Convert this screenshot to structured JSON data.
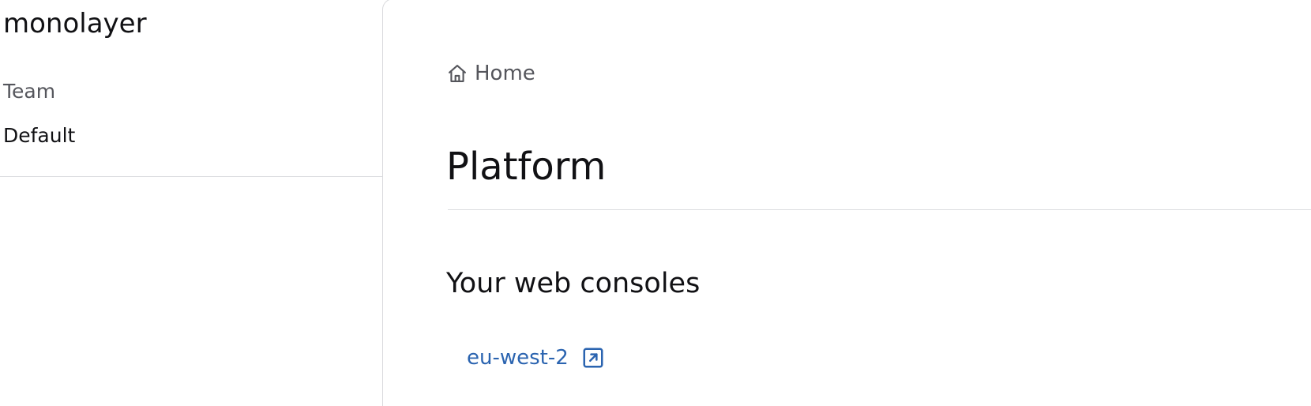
{
  "sidebar": {
    "brand": "monolayer",
    "team_label": "Team",
    "team_value": "Default"
  },
  "breadcrumb": {
    "icon": "home-icon",
    "label": "Home"
  },
  "main": {
    "title": "Platform",
    "section_heading": "Your web consoles",
    "consoles": [
      {
        "label": "eu-west-2",
        "icon": "external-link-icon"
      }
    ]
  },
  "colors": {
    "link": "#2b64b0",
    "muted_text": "#55565c",
    "text": "#111114",
    "divider": "#dcdde0"
  }
}
